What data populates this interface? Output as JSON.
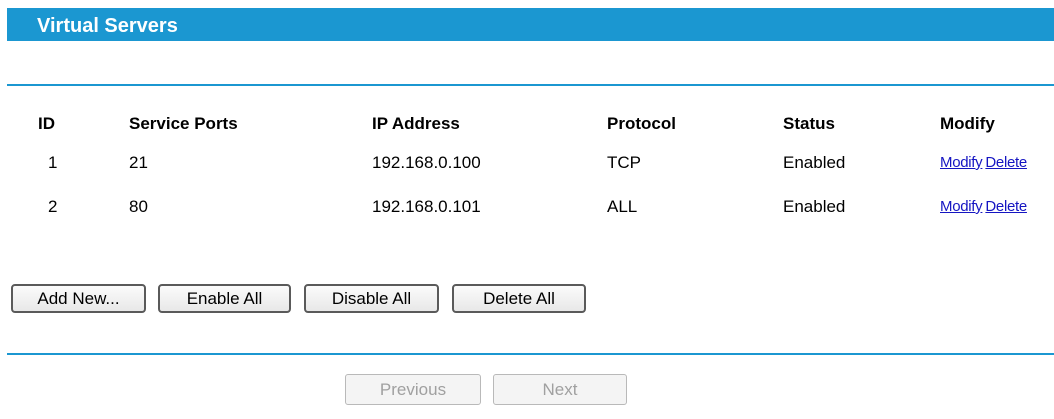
{
  "header": {
    "title": "Virtual Servers"
  },
  "table": {
    "columns": [
      "ID",
      "Service Ports",
      "IP Address",
      "Protocol",
      "Status",
      "Modify"
    ],
    "rows": [
      {
        "id": "1",
        "ports": "21",
        "ip": "192.168.0.100",
        "protocol": "TCP",
        "status": "Enabled",
        "modify": "Modify",
        "delete": "Delete"
      },
      {
        "id": "2",
        "ports": "80",
        "ip": "192.168.0.101",
        "protocol": "ALL",
        "status": "Enabled",
        "modify": "Modify",
        "delete": "Delete"
      }
    ]
  },
  "actions": {
    "add_new": "Add New...",
    "enable_all": "Enable All",
    "disable_all": "Disable All",
    "delete_all": "Delete All"
  },
  "pagination": {
    "previous": "Previous",
    "next": "Next"
  },
  "colors": {
    "accent": "#1b97d1",
    "link": "#1515c2"
  }
}
